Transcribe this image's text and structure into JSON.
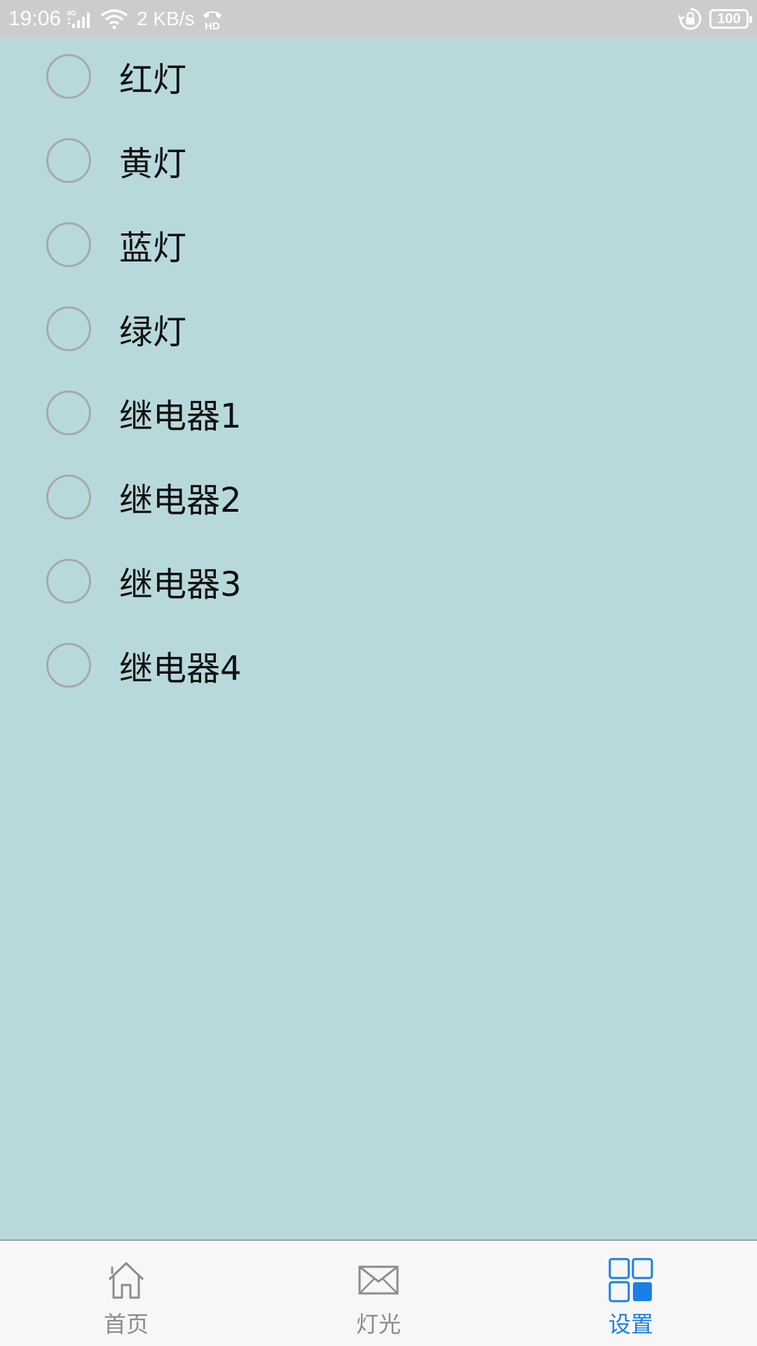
{
  "status_bar": {
    "time": "19:06",
    "network_type": "4G",
    "speed": "2 KB/s",
    "hd_label": "HD",
    "battery": "100",
    "icons": [
      "signal-icon",
      "wifi-icon",
      "hd-call-icon",
      "rotation-lock-icon",
      "battery-icon"
    ]
  },
  "options": [
    {
      "label": "红灯",
      "checked": false
    },
    {
      "label": "黄灯",
      "checked": false
    },
    {
      "label": "蓝灯",
      "checked": false
    },
    {
      "label": "绿灯",
      "checked": false
    },
    {
      "label": "继电器1",
      "checked": false
    },
    {
      "label": "继电器2",
      "checked": false
    },
    {
      "label": "继电器3",
      "checked": false
    },
    {
      "label": "继电器4",
      "checked": false
    }
  ],
  "bottom_nav": {
    "items": [
      {
        "label": "首页",
        "icon": "home-icon",
        "active": false
      },
      {
        "label": "灯光",
        "icon": "mail-icon",
        "active": false
      },
      {
        "label": "设置",
        "icon": "grid-icon",
        "active": true
      }
    ]
  },
  "colors": {
    "background": "#b8d9dc",
    "status_bar": "#cccccc",
    "nav_background": "#f7f7f7",
    "accent": "#1a7fe6",
    "inactive": "#8c8c8c"
  }
}
